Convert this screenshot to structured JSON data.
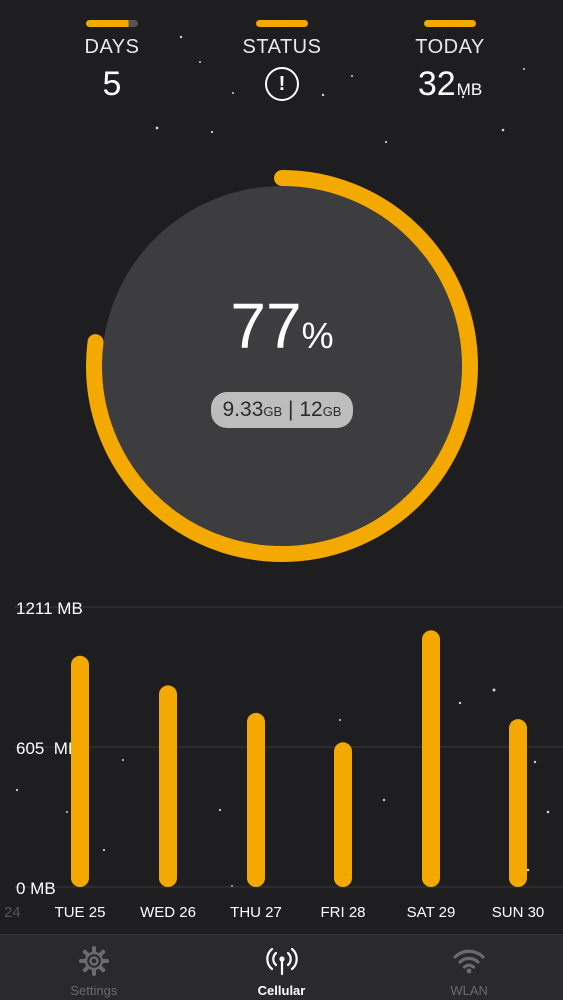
{
  "stats": {
    "days": {
      "label": "DAYS",
      "value": "5"
    },
    "status": {
      "label": "STATUS",
      "icon": "exclamation-circle-icon",
      "glyph": "!"
    },
    "today": {
      "label": "TODAY",
      "value": "32",
      "unit": "MB"
    }
  },
  "usage": {
    "percent": "77",
    "percent_symbol": "%",
    "used": "9.33",
    "used_unit": "GB",
    "separator": "|",
    "total": "12",
    "total_unit": "GB",
    "fraction": 0.77
  },
  "chart_data": {
    "type": "bar",
    "categories": [
      "TUE 25",
      "WED 26",
      "THU 27",
      "FRI 28",
      "SAT 29",
      "SUN 30"
    ],
    "partial_left_label": "24",
    "values": [
      1000,
      872,
      753,
      626,
      1110,
      726
    ],
    "y_tick_labels": [
      "1211 MB",
      "605  MB",
      "0 MB"
    ],
    "ylim": [
      0,
      1211
    ],
    "color": "#f4a900"
  },
  "tabs": [
    {
      "label": "Settings",
      "icon": "gear-icon",
      "active": false
    },
    {
      "label": "Cellular",
      "icon": "antenna-icon",
      "active": true
    },
    {
      "label": "WLAN",
      "icon": "wifi-icon",
      "active": false
    }
  ],
  "colors": {
    "accent": "#f4a900",
    "background": "#1e1e20",
    "ring_fill": "#3d3d3f"
  }
}
